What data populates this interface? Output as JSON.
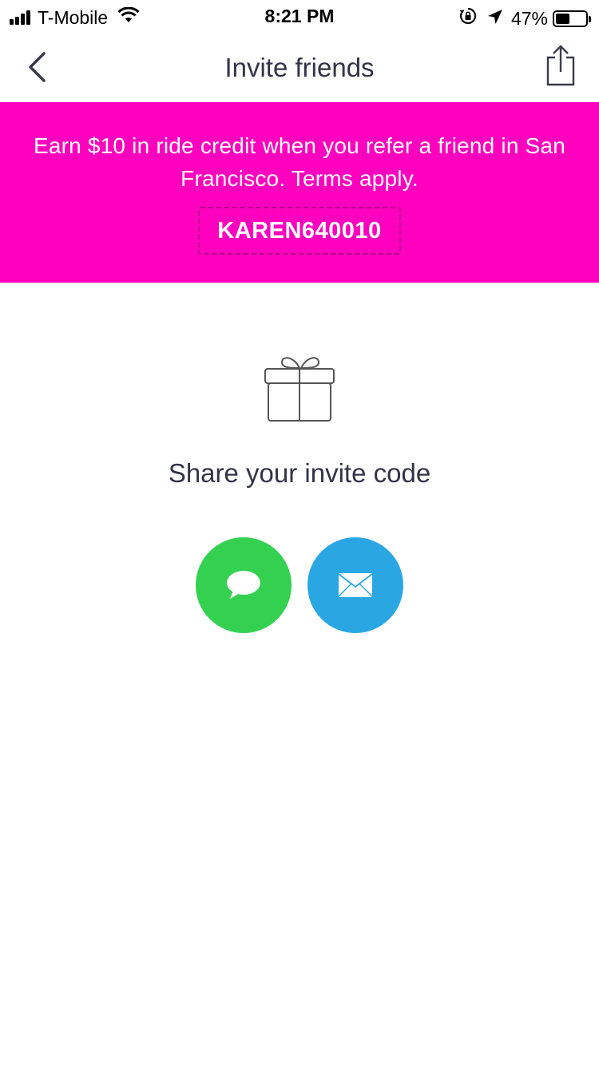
{
  "status_bar": {
    "carrier": "T-Mobile",
    "time": "8:21 PM",
    "battery_percent": "47%",
    "battery_level": 0.47,
    "icons": [
      "signal-icon",
      "wifi-icon",
      "orientation-lock-icon",
      "location-arrow-icon",
      "battery-icon"
    ]
  },
  "nav": {
    "title": "Invite friends",
    "back_icon": "chevron-left-icon",
    "share_icon": "share-icon"
  },
  "promo": {
    "text": "Earn $10 in ride credit when you refer a friend in San Francisco. Terms apply.",
    "invite_code": "KAREN640010",
    "background_color": "#ff00bf"
  },
  "main": {
    "icon": "gift-icon",
    "share_label": "Share your invite code",
    "buttons": [
      {
        "name": "message-button",
        "icon": "speech-bubble-icon",
        "color": "#34d151"
      },
      {
        "name": "email-button",
        "icon": "envelope-icon",
        "color": "#2aa7e3"
      }
    ]
  }
}
